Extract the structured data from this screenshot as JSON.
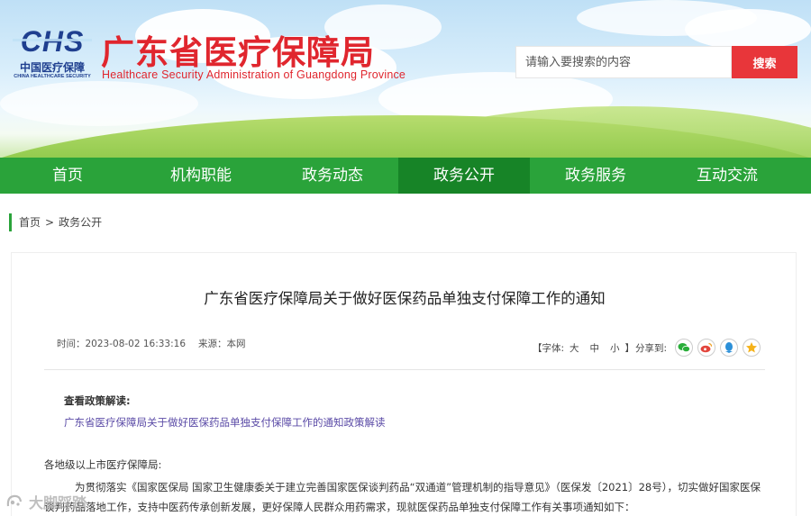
{
  "header": {
    "logo_mark": "CHS",
    "logo_cn": "中国医疗保障",
    "logo_en": "CHINA HEALTHCARE SECURITY",
    "site_title": "广东省医疗保障局",
    "site_subtitle": "Healthcare Security Administration of Guangdong Province",
    "search_placeholder": "请输入要搜索的内容",
    "search_button": "搜索"
  },
  "nav": {
    "items": [
      {
        "label": "首页"
      },
      {
        "label": "机构职能"
      },
      {
        "label": "政务动态"
      },
      {
        "label": "政务公开",
        "active": true
      },
      {
        "label": "政务服务"
      },
      {
        "label": "互动交流"
      }
    ]
  },
  "breadcrumb": {
    "home": "首页",
    "separator": ">",
    "current": "政务公开"
  },
  "article": {
    "title": "广东省医疗保障局关于做好医保药品单独支付保障工作的通知",
    "time": "时间：2023-08-02 16:33:16",
    "source": "来源：本网",
    "font_label_open": "【字体:",
    "font_large": "大",
    "font_medium": "中",
    "font_small": "小",
    "font_label_close": "】",
    "share_label": "分享到:",
    "share_icons": [
      "wechat-icon",
      "weibo-icon",
      "qq-icon",
      "qzone-icon"
    ],
    "policy_label": "查看政策解读:",
    "policy_link": "广东省医疗保障局关于做好医保药品单独支付保障工作的通知政策解读",
    "greeting": "各地级以上市医疗保障局:",
    "paragraph": "为贯彻落实《国家医保局 国家卫生健康委关于建立完善国家医保谈判药品“双通道”管理机制的指导意见》（医保发〔2021〕28号），切实做好国家医保谈判药品落地工作，支持中医药传承创新发展，更好保障人民群众用药需求，现就医保药品单独支付保障工作有关事项通知如下："
  },
  "watermark": {
    "text": "大脚踩踏"
  },
  "colors": {
    "brand_red": "#e0262e",
    "nav_green": "#2aa33a",
    "nav_active": "#178427",
    "search_red": "#e8363a",
    "link_purple": "#5a4aa6"
  }
}
